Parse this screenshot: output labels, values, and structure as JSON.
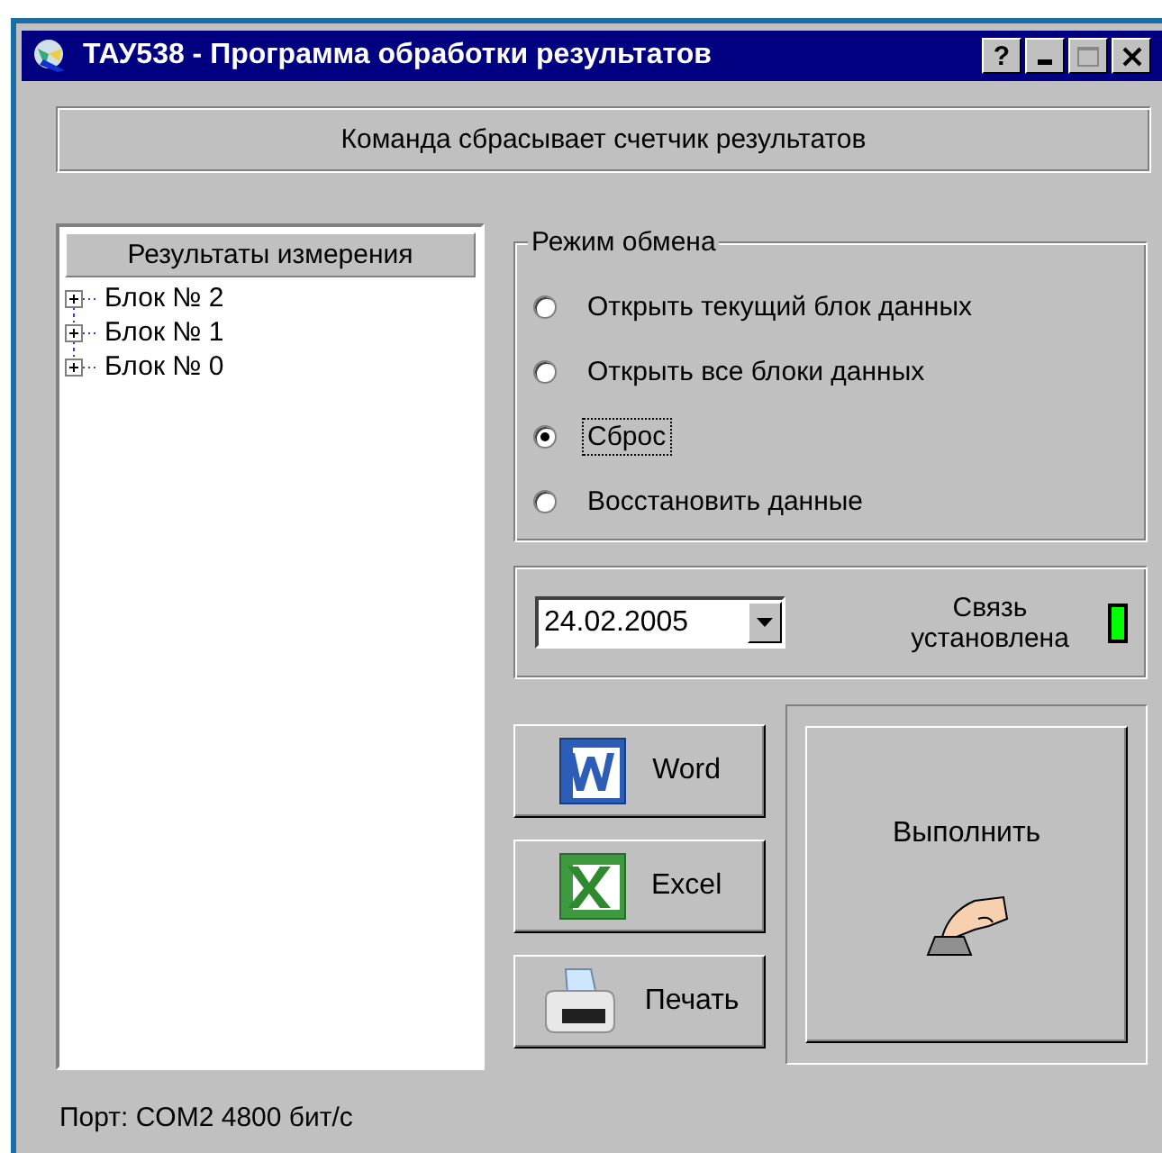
{
  "window": {
    "title": "ТАУ538 - Программа обработки результатов",
    "help": "?"
  },
  "message": "Команда сбрасывает счетчик результатов",
  "tree": {
    "header": "Результаты измерения",
    "items": [
      {
        "label": "Блок № 2",
        "expanded": false
      },
      {
        "label": "Блок № 1",
        "expanded": false
      },
      {
        "label": "Блок № 0",
        "expanded": false
      }
    ]
  },
  "exchange_mode": {
    "title": "Режим обмена",
    "options": [
      {
        "label": "Открыть текущий блок данных",
        "selected": false
      },
      {
        "label": "Открыть все блоки данных",
        "selected": false
      },
      {
        "label": "Сброс",
        "selected": true
      },
      {
        "label": "Восстановить данные",
        "selected": false
      }
    ]
  },
  "date": {
    "value": "24.02.2005"
  },
  "connection": {
    "label": "Связь установлена",
    "on": true
  },
  "export_buttons": [
    {
      "kind": "word",
      "label": "Word"
    },
    {
      "kind": "excel",
      "label": "Excel"
    },
    {
      "kind": "print",
      "label": "Печать"
    }
  ],
  "execute_button": {
    "label": "Выполнить"
  },
  "status_bar": "Порт: COM2 4800 бит/с"
}
